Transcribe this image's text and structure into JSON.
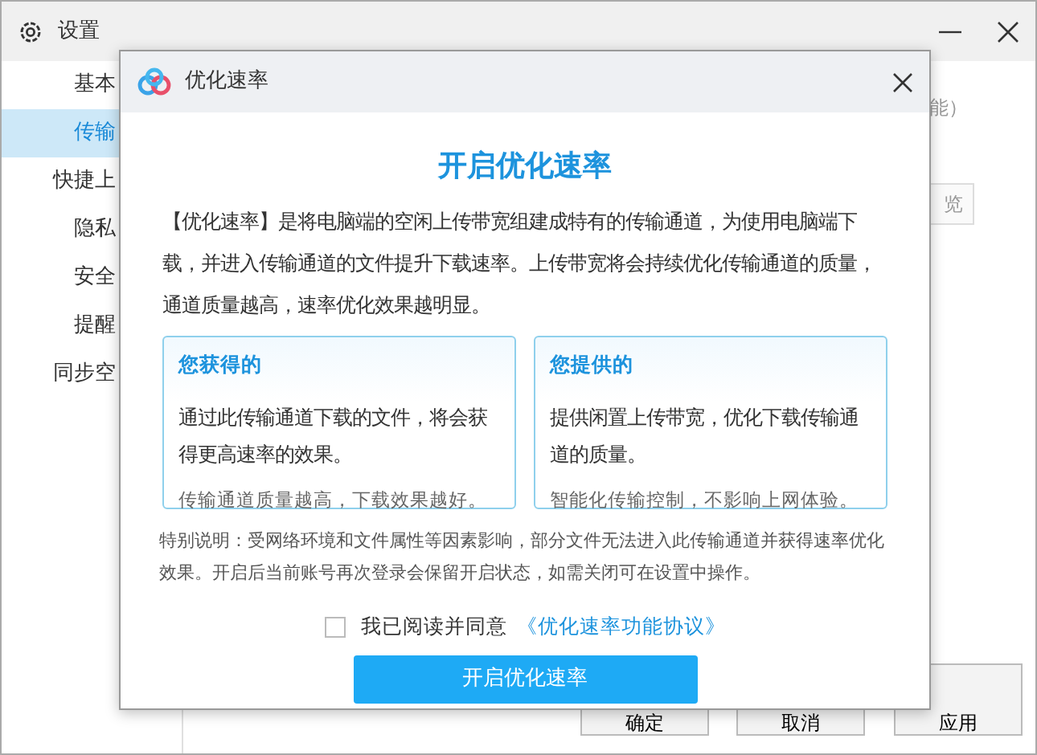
{
  "window": {
    "title": "设置"
  },
  "sidebar": {
    "items": [
      {
        "label": "基本",
        "selected": false
      },
      {
        "label": "传输",
        "selected": true
      },
      {
        "label": "快捷上",
        "selected": false
      },
      {
        "label": "隐私",
        "selected": false
      },
      {
        "label": "安全",
        "selected": false
      },
      {
        "label": "提醒",
        "selected": false
      },
      {
        "label": "同步空",
        "selected": false
      }
    ]
  },
  "content": {
    "fragments": [
      "能）"
    ],
    "browse_button": "览"
  },
  "footer_buttons": [
    "确定",
    "取消",
    "应用"
  ],
  "dialog": {
    "title": "优化速率",
    "heading": "开启优化速率",
    "intro": "【优化速率】是将电脑端的空闲上传带宽组建成特有的传输通道，为使用电脑端下载，并进入传输通道的文件提升下载速率。上传带宽将会持续优化传输通道的质量，通道质量越高，速率优化效果越明显。",
    "cards": [
      {
        "title": "您获得的",
        "text": "通过此传输通道下载的文件，将会获得更高速率的效果。",
        "note": "传输通道质量越高，下载效果越好。"
      },
      {
        "title": "您提供的",
        "text": "提供闲置上传带宽，优化下载传输通道的质量。",
        "note": "智能化传输控制，不影响上网体验。"
      }
    ],
    "notice": "特别说明：受网络环境和文件属性等因素影响，部分文件无法进入此传输通道并获得速率优化效果。开启后当前账号再次登录会保留开启状态，如需关闭可在设置中操作。",
    "agreement": {
      "checked": false,
      "label": "我已阅读并同意",
      "link": "《优化速率功能协议》"
    },
    "button": "开启优化速率"
  }
}
